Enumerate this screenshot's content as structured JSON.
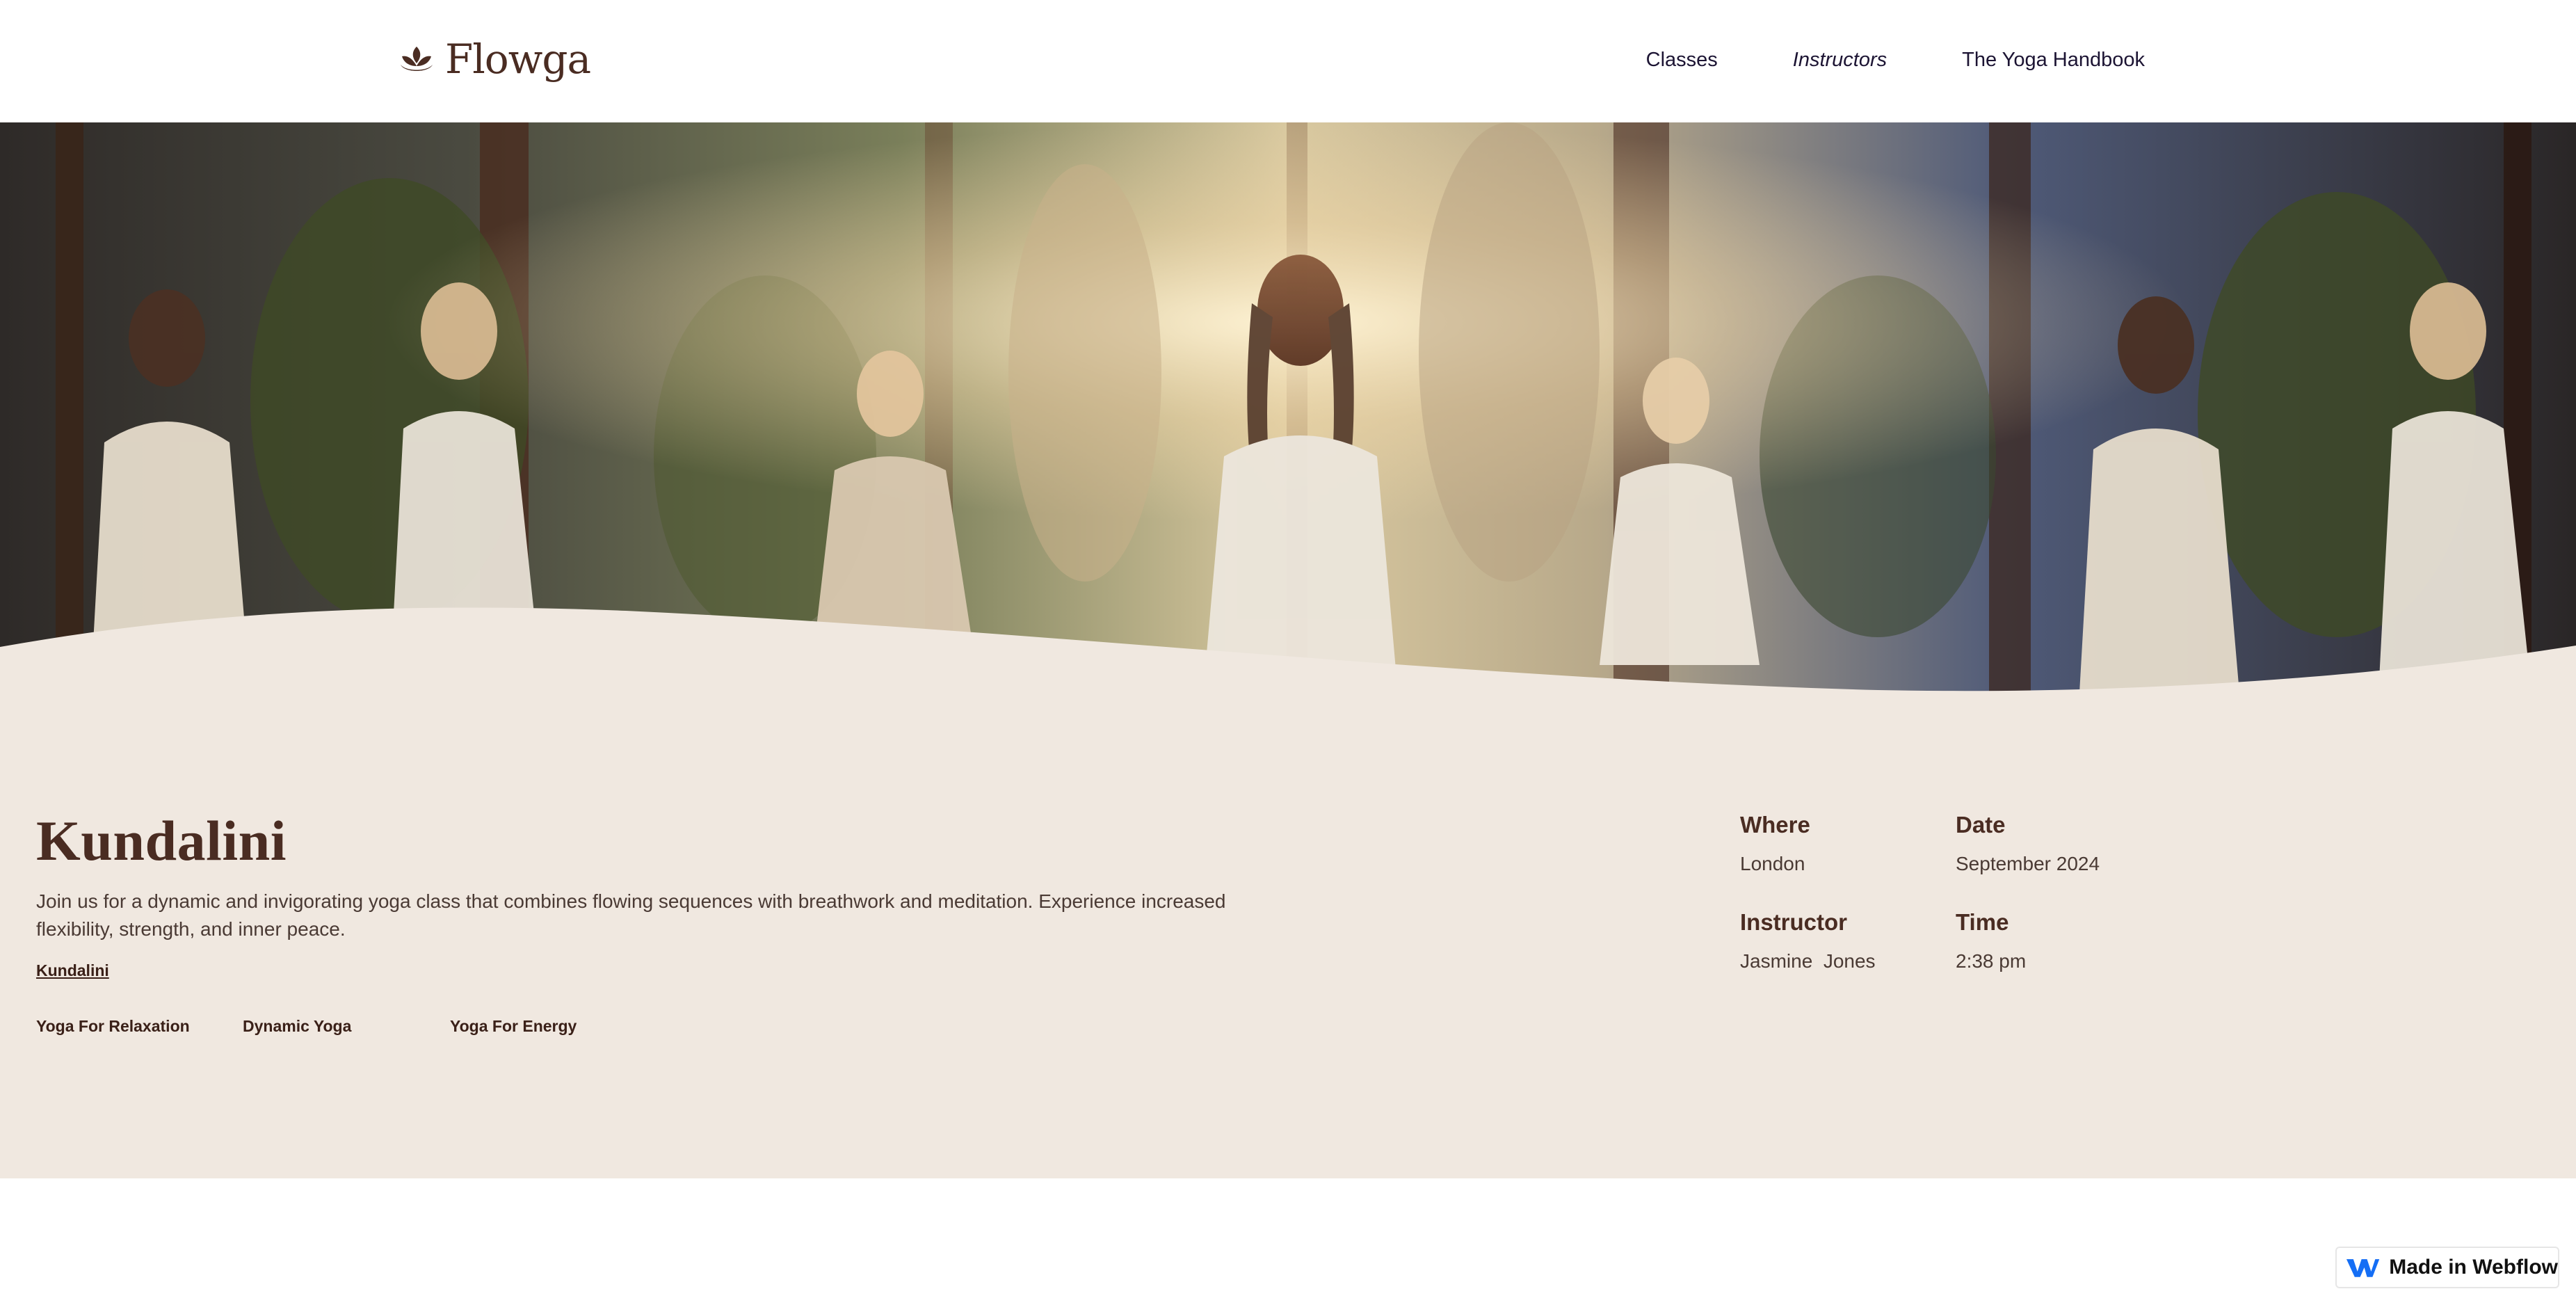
{
  "site": {
    "logo_text": "Flowga",
    "logo_icon": "lotus-icon"
  },
  "nav": {
    "items": [
      {
        "label": "Classes"
      },
      {
        "label": "Instructors"
      },
      {
        "label": "The Yoga Handbook"
      }
    ]
  },
  "hero": {
    "image": "photo of women meditating in a sunlit yoga studio"
  },
  "class": {
    "title": "Kundalini",
    "description": "Join us for a dynamic and invigorating yoga class that combines flowing sequences with breathwork and meditation. Experience increased flexibility, strength, and inner peace.",
    "category": "Kundalini",
    "tags": [
      "Yoga For Relaxation",
      "Dynamic Yoga",
      "Yoga For Energy"
    ]
  },
  "details": {
    "where_label": "Where",
    "where_value": "London",
    "date_label": "Date",
    "date_value": "September 2024",
    "instructor_label": "Instructor",
    "instructor_value": "Jasmine  Jones",
    "time_label": "Time",
    "time_value": "2:38 pm"
  },
  "badge": {
    "label": "Made in Webflow",
    "icon": "webflow-icon"
  },
  "colors": {
    "brand_brown": "#4a2c22",
    "band_bg": "#f0e8e0",
    "nav_text": "#1c1433"
  }
}
